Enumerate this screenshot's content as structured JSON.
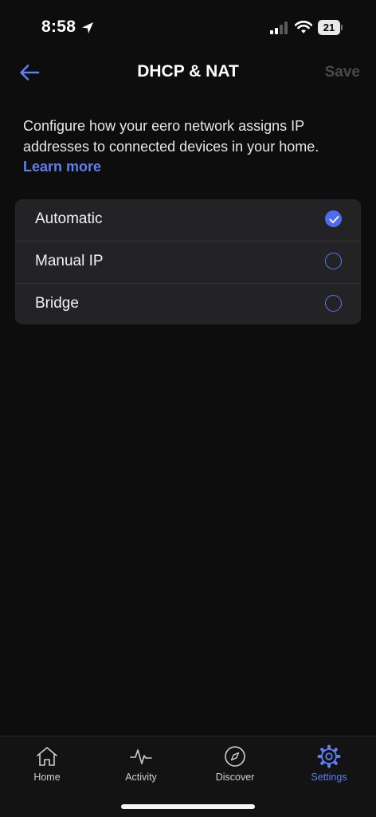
{
  "status_bar": {
    "time": "8:58",
    "battery": "21"
  },
  "nav": {
    "title": "DHCP & NAT",
    "save_label": "Save"
  },
  "description": {
    "text": "Configure how your eero network assigns IP addresses to connected devices in your home.",
    "link": "Learn more"
  },
  "options": [
    {
      "label": "Automatic",
      "selected": true
    },
    {
      "label": "Manual IP",
      "selected": false
    },
    {
      "label": "Bridge",
      "selected": false
    }
  ],
  "tabs": [
    {
      "label": "Home",
      "icon": "home-icon",
      "active": false
    },
    {
      "label": "Activity",
      "icon": "activity-icon",
      "active": false
    },
    {
      "label": "Discover",
      "icon": "compass-icon",
      "active": false
    },
    {
      "label": "Settings",
      "icon": "gear-icon",
      "active": true
    }
  ],
  "colors": {
    "accent": "#4e6cf2",
    "link": "#5d7ff0",
    "background": "#0d0d0d",
    "card": "#232325",
    "save_disabled": "#4a4a4a"
  }
}
